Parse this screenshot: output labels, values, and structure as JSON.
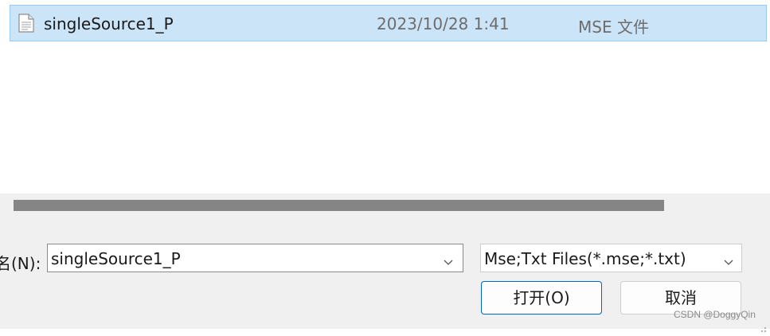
{
  "file_list": {
    "rows": [
      {
        "name": "singleSource1_P",
        "modified": "2023/10/28 1:41",
        "type": "MSE 文件",
        "icon": "document-icon"
      }
    ]
  },
  "footer": {
    "filename_label": "名(N):",
    "filename_value": "singleSource1_P",
    "filetype_value": "Mse;Txt Files(*.mse;*.txt)",
    "open_label": "打开(O)",
    "cancel_label": "取消",
    "watermark": "CSDN @DoggyQin"
  },
  "colors": {
    "selection": "#cce4f7",
    "selection_border": "#99c9ef",
    "panel": "#f0f0f0",
    "scrollbar": "#858585",
    "accent": "#0067c0"
  }
}
